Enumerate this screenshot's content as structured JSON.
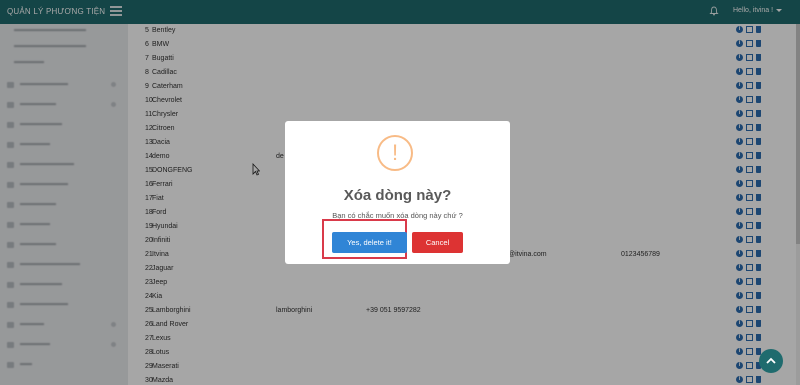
{
  "header": {
    "brand": "QUẢN LÝ PHƯƠNG TIỆN",
    "user": "Hello, itvina !"
  },
  "table": {
    "rows": [
      {
        "no": "5",
        "name": "Bentley",
        "col3": "",
        "col4": "",
        "col5": "",
        "col6": ""
      },
      {
        "no": "6",
        "name": "BMW",
        "col3": "",
        "col4": "",
        "col5": "",
        "col6": ""
      },
      {
        "no": "7",
        "name": "Bugatti",
        "col3": "",
        "col4": "",
        "col5": "",
        "col6": ""
      },
      {
        "no": "8",
        "name": "Cadillac",
        "col3": "",
        "col4": "",
        "col5": "",
        "col6": ""
      },
      {
        "no": "9",
        "name": "Caterham",
        "col3": "",
        "col4": "",
        "col5": "",
        "col6": ""
      },
      {
        "no": "10",
        "name": "Chevrolet",
        "col3": "",
        "col4": "",
        "col5": "",
        "col6": ""
      },
      {
        "no": "11",
        "name": "Chrysler",
        "col3": "",
        "col4": "",
        "col5": "",
        "col6": ""
      },
      {
        "no": "12",
        "name": "Citroen",
        "col3": "",
        "col4": "",
        "col5": "",
        "col6": ""
      },
      {
        "no": "13",
        "name": "Dacia",
        "col3": "",
        "col4": "",
        "col5": "",
        "col6": ""
      },
      {
        "no": "14",
        "name": "demo",
        "col3": "de",
        "col4": "",
        "col5": "",
        "col6": ""
      },
      {
        "no": "15",
        "name": "DONGFENG",
        "col3": "",
        "col4": "",
        "col5": "",
        "col6": ""
      },
      {
        "no": "16",
        "name": "Ferrari",
        "col3": "",
        "col4": "",
        "col5": "",
        "col6": ""
      },
      {
        "no": "17",
        "name": "Fiat",
        "col3": "",
        "col4": "",
        "col5": "",
        "col6": ""
      },
      {
        "no": "18",
        "name": "Ford",
        "col3": "",
        "col4": "",
        "col5": "",
        "col6": ""
      },
      {
        "no": "19",
        "name": "Hyundai",
        "col3": "",
        "col4": "",
        "col5": "",
        "col6": ""
      },
      {
        "no": "20",
        "name": "Infiniti",
        "col3": "",
        "col4": "",
        "col5": "",
        "col6": ""
      },
      {
        "no": "21",
        "name": "Itvina",
        "col3": "",
        "col4": "",
        "col5": "@itvina.com",
        "col6": "0123456789"
      },
      {
        "no": "22",
        "name": "Jaguar",
        "col3": "",
        "col4": "",
        "col5": "",
        "col6": ""
      },
      {
        "no": "23",
        "name": "Jeep",
        "col3": "",
        "col4": "",
        "col5": "",
        "col6": ""
      },
      {
        "no": "24",
        "name": "Kia",
        "col3": "",
        "col4": "",
        "col5": "",
        "col6": ""
      },
      {
        "no": "25",
        "name": "Lamborghini",
        "col3": "lamborghini",
        "col4": "+39 051 9597282",
        "col5": "",
        "col6": ""
      },
      {
        "no": "26",
        "name": "Land Rover",
        "col3": "",
        "col4": "",
        "col5": "",
        "col6": ""
      },
      {
        "no": "27",
        "name": "Lexus",
        "col3": "",
        "col4": "",
        "col5": "",
        "col6": ""
      },
      {
        "no": "28",
        "name": "Lotus",
        "col3": "",
        "col4": "",
        "col5": "",
        "col6": ""
      },
      {
        "no": "29",
        "name": "Maserati",
        "col3": "",
        "col4": "",
        "col5": "",
        "col6": ""
      },
      {
        "no": "30",
        "name": "Mazda",
        "col3": "",
        "col4": "",
        "col5": "",
        "col6": ""
      }
    ]
  },
  "modal": {
    "icon": "!",
    "title": "Xóa dòng này?",
    "text": "Bạn có chắc muốn xóa dòng này chứ ?",
    "confirm": "Yes, delete it!",
    "cancel": "Cancel"
  },
  "icons": {
    "menu": "hamburger-icon",
    "notifications": "bell-icon",
    "row_actions": [
      "info-icon",
      "edit-icon",
      "trash-icon"
    ],
    "scroll_top": "arrow-up-icon"
  },
  "colors": {
    "header": "#1f6b6e",
    "confirm_button": "#3085d6",
    "cancel_button": "#dd3333",
    "warning": "#f8bb86",
    "highlight": "#d93a4a"
  }
}
